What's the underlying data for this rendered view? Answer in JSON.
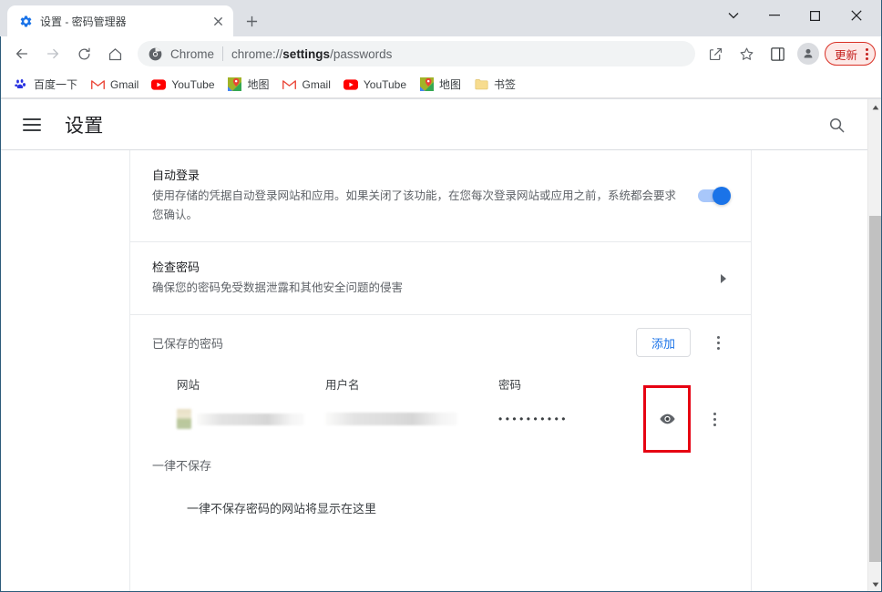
{
  "window": {
    "controls": {
      "tabsearch_label": "⌄",
      "minimize_label": "—",
      "maximize_label": "☐",
      "close_label": "✕"
    }
  },
  "tabstrip": {
    "tab": {
      "title": "设置 - 密码管理器",
      "favicon": "settings-gear-icon",
      "close_label": "✕"
    },
    "new_tab_label": "+"
  },
  "toolbar": {
    "back_label": "←",
    "forward_label": "→",
    "reload_label": "⟳",
    "home_label": "⌂",
    "omnibox": {
      "icon": "chrome-logo-icon",
      "chip_text": "Chrome",
      "url_prefix": "chrome://",
      "url_bold": "settings",
      "url_suffix": "/passwords"
    },
    "share_icon": "share-icon",
    "bookmark_icon": "star-icon",
    "sidepanel_icon": "side-panel-icon",
    "profile_icon": "avatar-icon",
    "update_label": "更新",
    "update_color": "#c5221f",
    "menu_icon": "three-dot-menu-icon"
  },
  "bookmarks": [
    {
      "label": "百度一下",
      "icon": "baidu-icon"
    },
    {
      "label": "Gmail",
      "icon": "gmail-icon"
    },
    {
      "label": "YouTube",
      "icon": "youtube-icon"
    },
    {
      "label": "地图",
      "icon": "google-maps-icon"
    },
    {
      "label": "Gmail",
      "icon": "gmail-icon"
    },
    {
      "label": "YouTube",
      "icon": "youtube-icon"
    },
    {
      "label": "地图",
      "icon": "google-maps-icon"
    },
    {
      "label": "书签",
      "icon": "folder-icon"
    }
  ],
  "settings": {
    "menu_icon": "hamburger-menu-icon",
    "title": "设置",
    "search_icon": "search-icon"
  },
  "passwords_page": {
    "autosignin": {
      "title": "自动登录",
      "description": "使用存储的凭据自动登录网站和应用。如果关闭了该功能，在您每次登录网站或应用之前，系统都会要求您确认。",
      "toggle_state": "on",
      "toggle_color": "#1a73e8"
    },
    "checkup": {
      "title": "检查密码",
      "description": "确保您的密码免受数据泄露和其他安全问题的侵害",
      "arrow_icon": "chevron-right-icon"
    },
    "saved": {
      "section_label": "已保存的密码",
      "add_label": "添加",
      "more_icon": "three-dot-menu-icon",
      "columns": [
        "网站",
        "用户名",
        "密码"
      ],
      "rows": [
        {
          "site": "",
          "site_redacted": true,
          "username": "",
          "username_redacted": true,
          "password_mask": "••••••••••",
          "show_icon": "eye-icon",
          "more_icon": "three-dot-menu-icon",
          "highlighted": true,
          "highlight_color": "#e60012"
        }
      ]
    },
    "never_saved": {
      "section_label": "一律不保存",
      "empty_text": "一律不保存密码的网站将显示在这里"
    }
  },
  "scrollbar": {
    "up_arrow": "▲",
    "down_arrow": "▼"
  }
}
